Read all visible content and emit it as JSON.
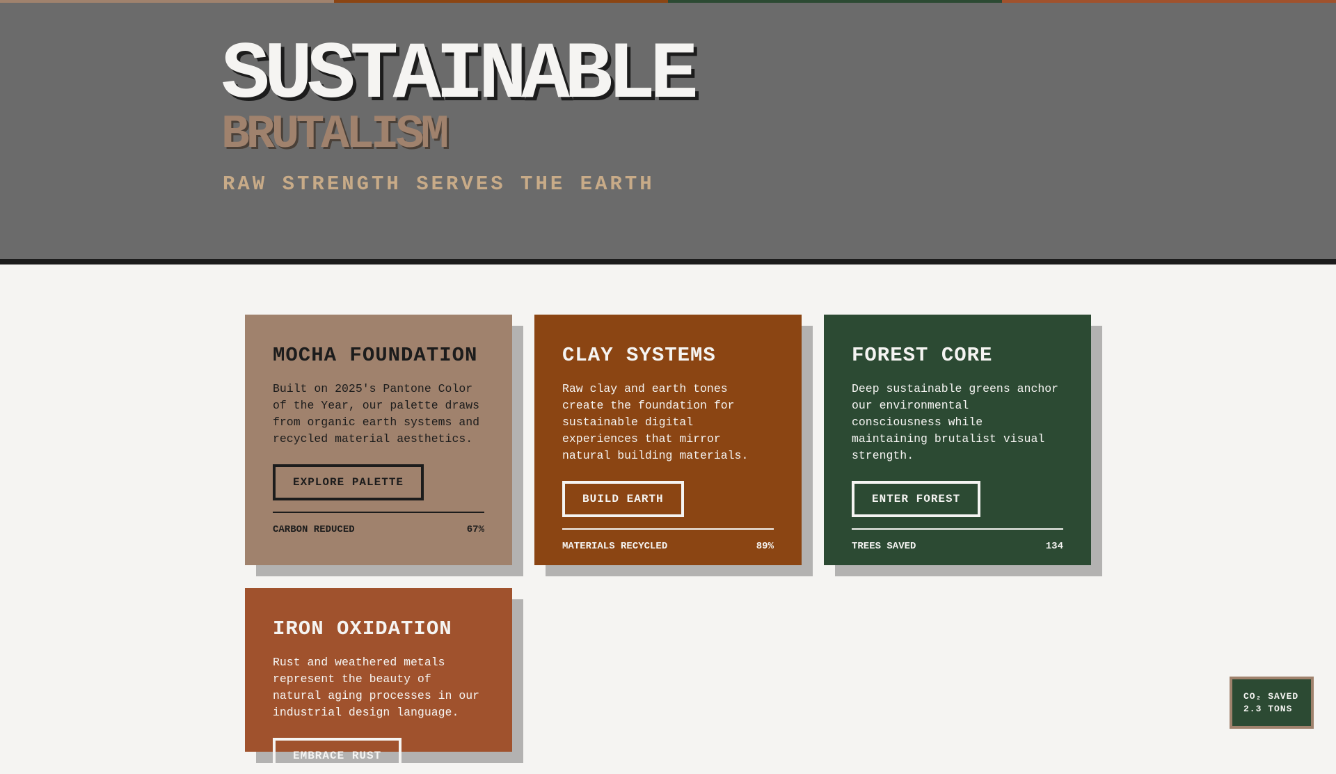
{
  "colors": {
    "mocha": "#a0826d",
    "clay": "#8b4513",
    "forest": "#2c4a33",
    "rust": "#a0522d",
    "charcoal": "#1c1c1c",
    "concrete": "#6b6b6b",
    "paper": "#f5f4f2",
    "tan": "#c8ab88"
  },
  "stripe": [
    "#a0826d",
    "#8b4513",
    "#2c4a33",
    "#a0522d"
  ],
  "hero": {
    "title": "SUSTAINABLE",
    "subtitle": "BRUTALISM",
    "tagline": "RAW STRENGTH SERVES THE EARTH"
  },
  "cards": [
    {
      "title": "MOCHA FOUNDATION",
      "body": "Built on 2025's Pantone Color of the Year, our palette draws from organic earth systems and recycled material aesthetics.",
      "button": "EXPLORE PALETTE",
      "metric_label": "CARBON REDUCED",
      "metric_value": "67%",
      "bg": "#a0826d"
    },
    {
      "title": "CLAY SYSTEMS",
      "body": "Raw clay and earth tones create the foundation for sustainable digital experiences that mirror natural building materials.",
      "button": "BUILD EARTH",
      "metric_label": "MATERIALS RECYCLED",
      "metric_value": "89%",
      "bg": "#8b4513"
    },
    {
      "title": "FOREST CORE",
      "body": "Deep sustainable greens anchor our environmental consciousness while maintaining brutalist visual strength.",
      "button": "ENTER FOREST",
      "metric_label": "TREES SAVED",
      "metric_value": "134",
      "bg": "#2c4a33"
    },
    {
      "title": "IRON OXIDATION",
      "body": "Rust and weathered metals represent the beauty of natural aging processes in our industrial design language.",
      "button": "EMBRACE RUST",
      "bg": "#a0522d"
    }
  ],
  "badge": {
    "line1": "CO₂ SAVED",
    "line2": "2.3 TONS"
  }
}
